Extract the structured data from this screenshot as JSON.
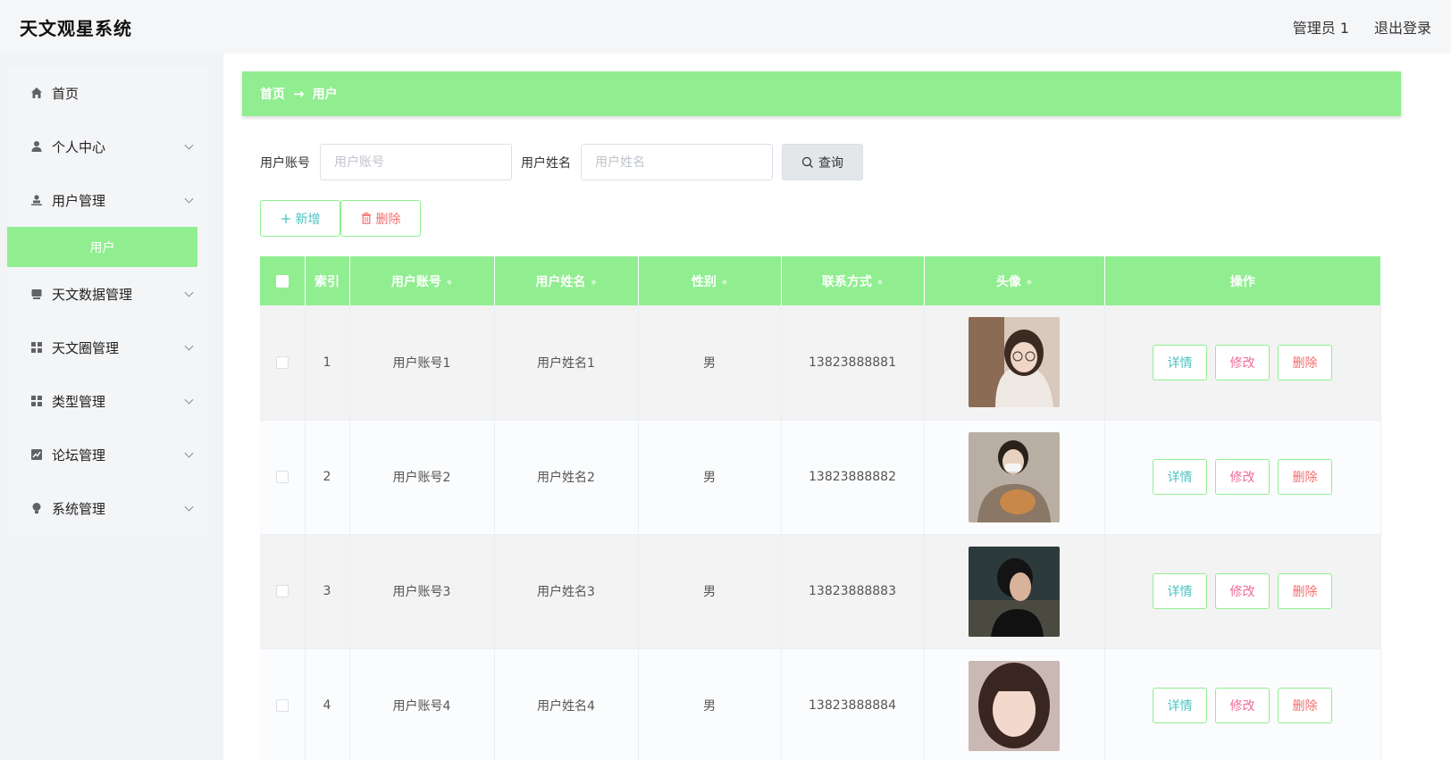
{
  "header": {
    "title": "天文观星系统",
    "user": "管理员 1",
    "logout": "退出登录"
  },
  "sidebar": {
    "items": [
      {
        "label": "首页",
        "icon": "home-icon",
        "expandable": false
      },
      {
        "label": "个人中心",
        "icon": "user-icon",
        "expandable": true
      },
      {
        "label": "用户管理",
        "icon": "user-manage-icon",
        "expandable": true
      },
      {
        "label": "天文数据管理",
        "icon": "data-icon",
        "expandable": true
      },
      {
        "label": "天文圈管理",
        "icon": "grid-icon",
        "expandable": true
      },
      {
        "label": "类型管理",
        "icon": "grid-icon",
        "expandable": true
      },
      {
        "label": "论坛管理",
        "icon": "chart-icon",
        "expandable": true
      },
      {
        "label": "系统管理",
        "icon": "bulb-icon",
        "expandable": true
      }
    ],
    "active_sub": "用户"
  },
  "breadcrumb": {
    "home": "首页",
    "arrow": "→",
    "current": "用户"
  },
  "search": {
    "account_label": "用户账号",
    "account_placeholder": "用户账号",
    "name_label": "用户姓名",
    "name_placeholder": "用户姓名",
    "query_btn": "查询"
  },
  "actions": {
    "add": "新增",
    "delete": "删除"
  },
  "table": {
    "columns": [
      "索引",
      "用户账号",
      "用户姓名",
      "性别",
      "联系方式",
      "头像",
      "操作"
    ],
    "rows": [
      {
        "index": "1",
        "account": "用户账号1",
        "name": "用户姓名1",
        "gender": "男",
        "phone": "13823888881"
      },
      {
        "index": "2",
        "account": "用户账号2",
        "name": "用户姓名2",
        "gender": "男",
        "phone": "13823888882"
      },
      {
        "index": "3",
        "account": "用户账号3",
        "name": "用户姓名3",
        "gender": "男",
        "phone": "13823888883"
      },
      {
        "index": "4",
        "account": "用户账号4",
        "name": "用户姓名4",
        "gender": "男",
        "phone": "13823888884"
      }
    ],
    "ops": {
      "detail": "详情",
      "edit": "修改",
      "delete": "删除"
    }
  },
  "colors": {
    "accent": "#90ee90",
    "teal": "#4ec3c3",
    "pink": "#f06a9a",
    "red": "#f56c6c"
  }
}
